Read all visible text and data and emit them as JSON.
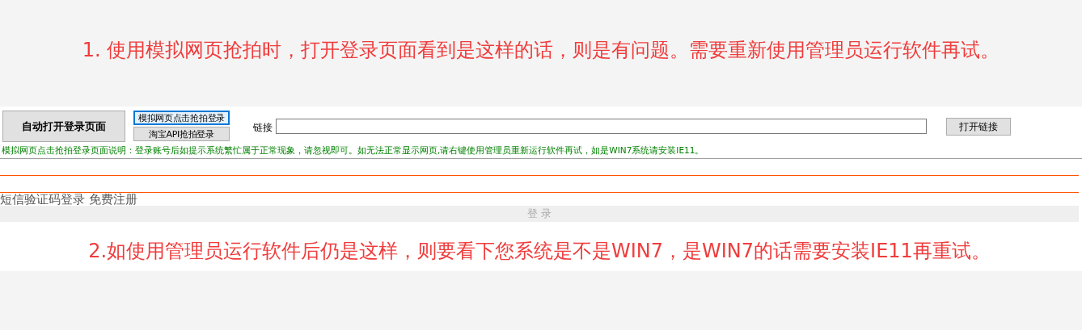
{
  "notice_top": "1. 使用模拟网页抢拍时，打开登录页面看到是这样的话，则是有问题。需要重新使用管理员运行软件再试。",
  "toolbar": {
    "main_button": "自动打开登录页面",
    "mode_buttons": [
      {
        "label": "模拟网页点击抢拍登录",
        "focused": true
      },
      {
        "label": "淘宝API抢拍登录",
        "focused": false
      }
    ],
    "link_label": "链接",
    "open_button": "打开链接"
  },
  "note": "模拟网页点击抢拍登录页面说明：登录账号后如提示系统繁忙属于正常现象，请忽视即可。如无法正常显示网页,请右键使用管理员重新运行软件再试，如是WIN7系统请安装IE11。",
  "login_page": {
    "links": "短信验证码登录 免费注册",
    "login_button": "登 录"
  },
  "notice_bottom": "2.如使用管理员运行软件后仍是这样，则要看下您系统是不是WIN7，是WIN7的话需要安装IE11再重试。"
}
